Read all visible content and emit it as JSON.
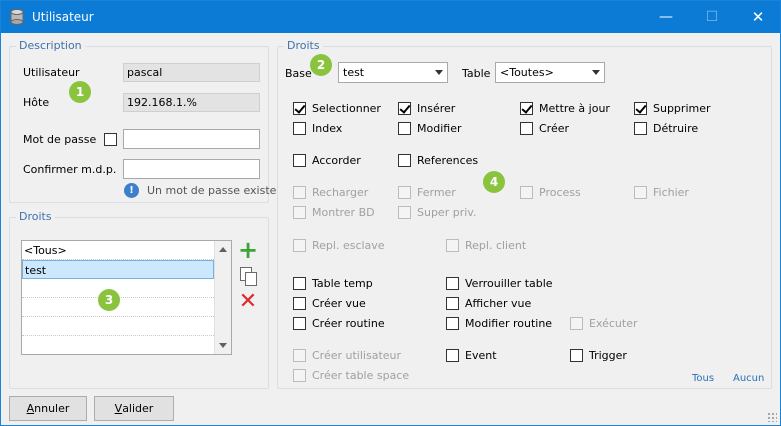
{
  "window": {
    "title": "Utilisateur"
  },
  "description": {
    "legend": "Description",
    "user_label": "Utilisateur",
    "user_value": "pascal",
    "host_label": "Hôte",
    "host_value": "192.168.1.%",
    "password_label": "Mot de passe",
    "password_value": "",
    "confirm_label": "Confirmer m.d.p.",
    "confirm_value": "",
    "password_info": "Un mot de passe existe"
  },
  "droits_left": {
    "legend": "Droits",
    "items": [
      "<Tous>",
      "test"
    ],
    "selected": "test"
  },
  "droits_right": {
    "legend": "Droits",
    "base_label": "Base",
    "base_value": "test",
    "table_label": "Table",
    "table_value": "<Toutes>",
    "privileges": {
      "selectionner": "Selectionner",
      "inserer": "Insérer",
      "mettre_a_jour": "Mettre à jour",
      "supprimer": "Supprimer",
      "index": "Index",
      "modifier": "Modifier",
      "creer": "Créer",
      "detruire": "Détruire",
      "accorder": "Accorder",
      "references": "References",
      "recharger": "Recharger",
      "fermer": "Fermer",
      "process": "Process",
      "fichier": "Fichier",
      "montrer_bd": "Montrer BD",
      "super_priv": "Super priv.",
      "repl_esclave": "Repl. esclave",
      "repl_client": "Repl. client",
      "table_temp": "Table temp",
      "verrouiller_table": "Verrouiller table",
      "creer_vue": "Créer vue",
      "afficher_vue": "Afficher vue",
      "creer_routine": "Créer routine",
      "modifier_routine": "Modifier routine",
      "executer": "Exécuter",
      "creer_utilisateur": "Créer utilisateur",
      "event": "Event",
      "trigger": "Trigger",
      "creer_table_space": "Créer table space"
    },
    "checked": [
      "selectionner",
      "inserer",
      "mettre_a_jour",
      "supprimer"
    ],
    "all_link": "Tous",
    "none_link": "Aucun"
  },
  "buttons": {
    "cancel_accel": "A",
    "cancel_rest": "nnuler",
    "ok_accel": "V",
    "ok_rest": "alider"
  },
  "callouts": [
    "1",
    "2",
    "3",
    "4"
  ],
  "colors": {
    "titlebar": "#0c7bd6",
    "legend": "#3f71ad",
    "badge": "#8ac43f"
  }
}
